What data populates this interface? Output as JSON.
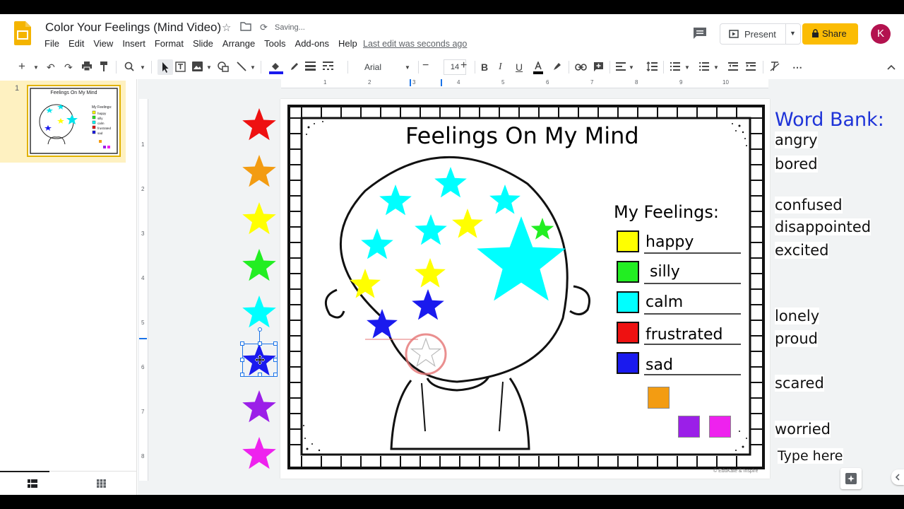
{
  "doc": {
    "title": "Color Your Feelings (Mind Video)",
    "status": "Saving...",
    "last_edit": "Last edit was seconds ago"
  },
  "menu": [
    "File",
    "Edit",
    "View",
    "Insert",
    "Format",
    "Slide",
    "Arrange",
    "Tools",
    "Add-ons",
    "Help"
  ],
  "header": {
    "present_label": "Present",
    "share_label": "Share",
    "avatar_initial": "K"
  },
  "toolbar": {
    "font": "Arial",
    "font_size": "14",
    "icons": [
      "add-icon",
      "undo-icon",
      "redo-icon",
      "print-icon",
      "paint-format-icon",
      "zoom-icon",
      "select-icon",
      "textbox-icon",
      "image-icon",
      "shape-icon",
      "line-icon",
      "fill-color-icon",
      "border-color-icon",
      "border-weight-icon",
      "border-dash-icon",
      "bold-icon",
      "italic-icon",
      "underline-icon",
      "text-color-icon",
      "highlight-icon",
      "link-icon",
      "comment-add-icon",
      "align-icon",
      "line-spacing-icon",
      "numbered-list-icon",
      "bulleted-list-icon",
      "decrease-indent-icon",
      "increase-indent-icon",
      "clear-format-icon",
      "more-icon"
    ]
  },
  "filmstrip": {
    "slide_number": "1",
    "thumb_title": "Feelings On My Mind",
    "thumb_feelings_title": "My Feelings:",
    "thumb_labels": [
      "happy",
      "silly",
      "calm",
      "frustrated",
      "sad"
    ]
  },
  "ruler": {
    "top_ticks": [
      "1",
      "2",
      "3",
      "4",
      "5",
      "6",
      "7",
      "8",
      "9",
      "10"
    ],
    "left_ticks": [
      "1",
      "2",
      "3",
      "4",
      "5",
      "6",
      "7",
      "8"
    ]
  },
  "slide": {
    "title": "Feelings On My Mind",
    "feelings_title": "My Feelings:",
    "feelings": [
      {
        "label": "happy",
        "color": "#ffff00"
      },
      {
        "label": "silly",
        "color": "#22ee22"
      },
      {
        "label": "calm",
        "color": "#00ffff"
      },
      {
        "label": "frustrated",
        "color": "#ee1111"
      },
      {
        "label": "sad",
        "color": "#1a1aee"
      }
    ],
    "extra_swatches": [
      "#f39c12",
      "#9b1fe8",
      "#ee22ee"
    ],
    "copyright": "© EduKate & Inspire"
  },
  "palette_stars": [
    "#ee1111",
    "#f39c12",
    "#ffff00",
    "#22ee22",
    "#00ffff",
    "#1a1aee",
    "#9b1fe8",
    "#ee22ee"
  ],
  "word_bank": {
    "title": "Word Bank:",
    "words": [
      "angry",
      "bored",
      "confused",
      "disappointed",
      "excited",
      "lonely",
      "proud",
      "scared",
      "worried"
    ],
    "placeholder": "Type here"
  }
}
